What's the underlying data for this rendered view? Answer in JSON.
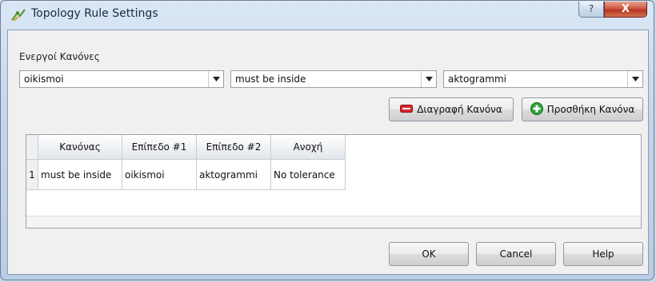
{
  "window": {
    "title": "Topology Rule Settings",
    "help_glyph": "?",
    "close_glyph": "X"
  },
  "rules_section": {
    "label": "Ενεργοί Κανόνες",
    "layer1_combo": "oikismoi",
    "rule_combo": "must be inside",
    "layer2_combo": "aktogrammi"
  },
  "actions": {
    "delete_rule": "Διαγραφή Κανόνα",
    "add_rule": "Προσθήκη Κανόνα"
  },
  "table": {
    "headers": [
      "Κανόνας",
      "Επίπεδο #1",
      "Επίπεδο #2",
      "Ανοχή"
    ],
    "rows": [
      {
        "num": "1",
        "rule": "must be inside",
        "layer1": "oikismoi",
        "layer2": "aktogrammi",
        "tolerance": "No tolerance"
      }
    ]
  },
  "footer": {
    "ok": "OK",
    "cancel": "Cancel",
    "help": "Help"
  },
  "colors": {
    "delete_icon": "#d9262b",
    "add_icon": "#2fa23a"
  }
}
